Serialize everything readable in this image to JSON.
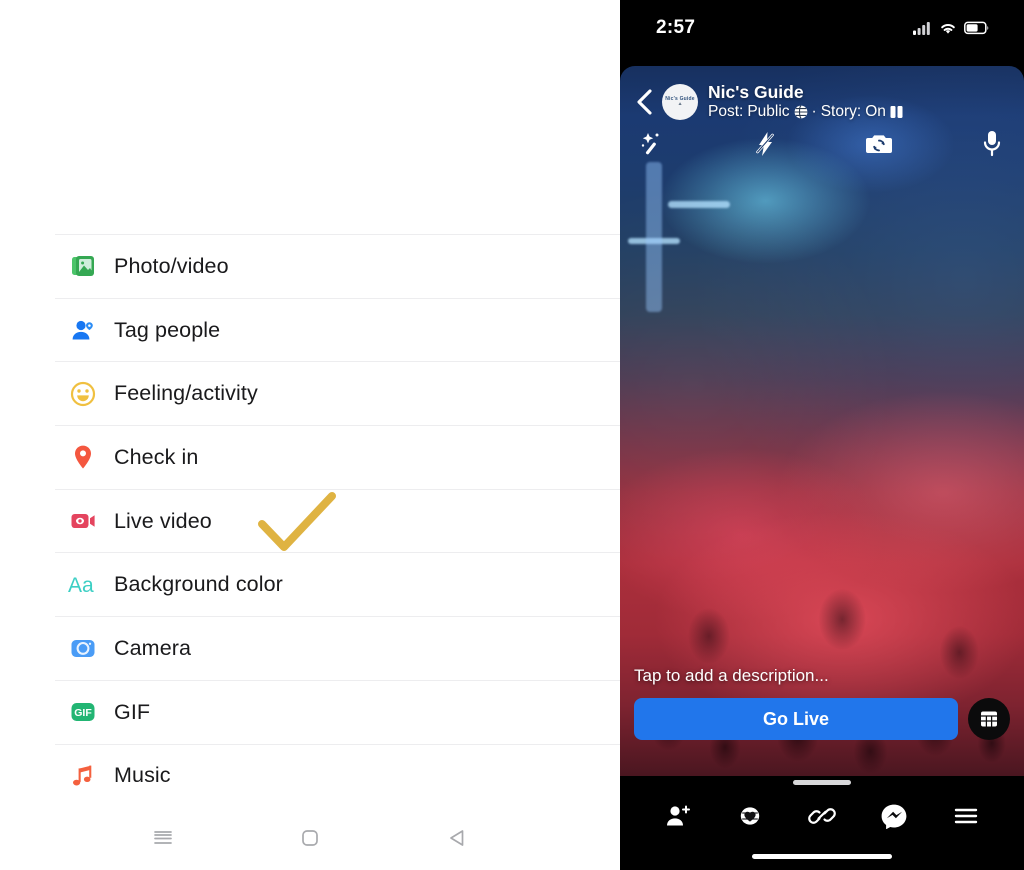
{
  "composer": {
    "panel_name": "facebook-composer-options",
    "items": [
      {
        "label": "Photo/video",
        "icon": "photo-video-icon",
        "color": "#42b05c"
      },
      {
        "label": "Tag people",
        "icon": "tag-people-icon",
        "color": "#1877f2"
      },
      {
        "label": "Feeling/activity",
        "icon": "feeling-activity-icon",
        "color": "#f5c33b"
      },
      {
        "label": "Check in",
        "icon": "check-in-pin-icon",
        "color": "#f5533d"
      },
      {
        "label": "Live video",
        "icon": "live-video-icon",
        "color": "#e4445e"
      },
      {
        "label": "Background color",
        "icon": "background-color-icon",
        "color": "#3ccfc4"
      },
      {
        "label": "Camera",
        "icon": "camera-icon",
        "color": "#4a9cf6"
      },
      {
        "label": "GIF",
        "icon": "gif-icon",
        "color": "#22b573"
      },
      {
        "label": "Music",
        "icon": "music-note-icon",
        "color": "#f4603e"
      }
    ],
    "annotation": {
      "name": "checkmark-annotation",
      "target_label": "Live video",
      "color": "#dfb342"
    }
  },
  "android_nav": {
    "buttons": [
      {
        "name": "recents-button",
        "icon": "recents-icon"
      },
      {
        "name": "home-button",
        "icon": "home-square-icon"
      },
      {
        "name": "back-button",
        "icon": "back-triangle-icon"
      }
    ]
  },
  "phone": {
    "status_bar": {
      "time": "2:57",
      "cellular_icon": "cellular-signal-icon",
      "wifi_icon": "wifi-icon",
      "battery_icon": "battery-icon"
    },
    "live_header": {
      "back_icon": "back-chevron-icon",
      "avatar": "profile-avatar",
      "avatar_text": "Nic's Guide",
      "avatar_subtext": "⛰",
      "name": "Nic's Guide",
      "post_prefix": "Post:",
      "post_audience": "Public",
      "audience_icon": "globe-icon",
      "separator": "·",
      "story_prefix": "Story:",
      "story_state": "On",
      "story_icon": "story-book-icon"
    },
    "camera_tools": [
      {
        "name": "effects-button",
        "icon": "magic-wand-sparkle-icon"
      },
      {
        "name": "flash-toggle-button",
        "icon": "flash-off-icon"
      },
      {
        "name": "flip-camera-button",
        "icon": "camera-flip-icon"
      },
      {
        "name": "microphone-button",
        "icon": "microphone-icon"
      }
    ],
    "bottom": {
      "description_placeholder": "Tap to add a description...",
      "go_live_label": "Go Live",
      "go_live_color": "#2176eb",
      "grid_button_icon": "grid-panel-icon"
    },
    "tab_bar": [
      {
        "name": "invite-friends-button",
        "icon": "add-person-icon"
      },
      {
        "name": "fundraiser-button",
        "icon": "heart-badge-icon"
      },
      {
        "name": "share-link-button",
        "icon": "link-chain-icon"
      },
      {
        "name": "messenger-button",
        "icon": "messenger-icon"
      },
      {
        "name": "more-options-button",
        "icon": "hamburger-menu-icon"
      }
    ],
    "drag_handle": "sheet-drag-handle",
    "home_indicator": "home-indicator"
  }
}
